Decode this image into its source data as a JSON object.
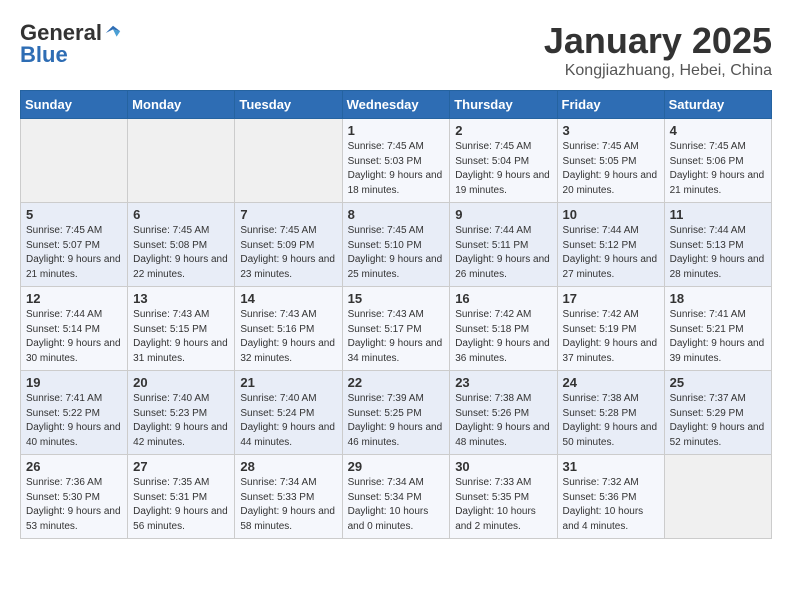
{
  "header": {
    "logo": {
      "general": "General",
      "blue": "Blue"
    },
    "title": "January 2025",
    "subtitle": "Kongjiazhuang, Hebei, China"
  },
  "weekdays": [
    "Sunday",
    "Monday",
    "Tuesday",
    "Wednesday",
    "Thursday",
    "Friday",
    "Saturday"
  ],
  "weeks": [
    [
      {
        "day": "",
        "sunrise": "",
        "sunset": "",
        "daylight": ""
      },
      {
        "day": "",
        "sunrise": "",
        "sunset": "",
        "daylight": ""
      },
      {
        "day": "",
        "sunrise": "",
        "sunset": "",
        "daylight": ""
      },
      {
        "day": "1",
        "sunrise": "Sunrise: 7:45 AM",
        "sunset": "Sunset: 5:03 PM",
        "daylight": "Daylight: 9 hours and 18 minutes."
      },
      {
        "day": "2",
        "sunrise": "Sunrise: 7:45 AM",
        "sunset": "Sunset: 5:04 PM",
        "daylight": "Daylight: 9 hours and 19 minutes."
      },
      {
        "day": "3",
        "sunrise": "Sunrise: 7:45 AM",
        "sunset": "Sunset: 5:05 PM",
        "daylight": "Daylight: 9 hours and 20 minutes."
      },
      {
        "day": "4",
        "sunrise": "Sunrise: 7:45 AM",
        "sunset": "Sunset: 5:06 PM",
        "daylight": "Daylight: 9 hours and 21 minutes."
      }
    ],
    [
      {
        "day": "5",
        "sunrise": "Sunrise: 7:45 AM",
        "sunset": "Sunset: 5:07 PM",
        "daylight": "Daylight: 9 hours and 21 minutes."
      },
      {
        "day": "6",
        "sunrise": "Sunrise: 7:45 AM",
        "sunset": "Sunset: 5:08 PM",
        "daylight": "Daylight: 9 hours and 22 minutes."
      },
      {
        "day": "7",
        "sunrise": "Sunrise: 7:45 AM",
        "sunset": "Sunset: 5:09 PM",
        "daylight": "Daylight: 9 hours and 23 minutes."
      },
      {
        "day": "8",
        "sunrise": "Sunrise: 7:45 AM",
        "sunset": "Sunset: 5:10 PM",
        "daylight": "Daylight: 9 hours and 25 minutes."
      },
      {
        "day": "9",
        "sunrise": "Sunrise: 7:44 AM",
        "sunset": "Sunset: 5:11 PM",
        "daylight": "Daylight: 9 hours and 26 minutes."
      },
      {
        "day": "10",
        "sunrise": "Sunrise: 7:44 AM",
        "sunset": "Sunset: 5:12 PM",
        "daylight": "Daylight: 9 hours and 27 minutes."
      },
      {
        "day": "11",
        "sunrise": "Sunrise: 7:44 AM",
        "sunset": "Sunset: 5:13 PM",
        "daylight": "Daylight: 9 hours and 28 minutes."
      }
    ],
    [
      {
        "day": "12",
        "sunrise": "Sunrise: 7:44 AM",
        "sunset": "Sunset: 5:14 PM",
        "daylight": "Daylight: 9 hours and 30 minutes."
      },
      {
        "day": "13",
        "sunrise": "Sunrise: 7:43 AM",
        "sunset": "Sunset: 5:15 PM",
        "daylight": "Daylight: 9 hours and 31 minutes."
      },
      {
        "day": "14",
        "sunrise": "Sunrise: 7:43 AM",
        "sunset": "Sunset: 5:16 PM",
        "daylight": "Daylight: 9 hours and 32 minutes."
      },
      {
        "day": "15",
        "sunrise": "Sunrise: 7:43 AM",
        "sunset": "Sunset: 5:17 PM",
        "daylight": "Daylight: 9 hours and 34 minutes."
      },
      {
        "day": "16",
        "sunrise": "Sunrise: 7:42 AM",
        "sunset": "Sunset: 5:18 PM",
        "daylight": "Daylight: 9 hours and 36 minutes."
      },
      {
        "day": "17",
        "sunrise": "Sunrise: 7:42 AM",
        "sunset": "Sunset: 5:19 PM",
        "daylight": "Daylight: 9 hours and 37 minutes."
      },
      {
        "day": "18",
        "sunrise": "Sunrise: 7:41 AM",
        "sunset": "Sunset: 5:21 PM",
        "daylight": "Daylight: 9 hours and 39 minutes."
      }
    ],
    [
      {
        "day": "19",
        "sunrise": "Sunrise: 7:41 AM",
        "sunset": "Sunset: 5:22 PM",
        "daylight": "Daylight: 9 hours and 40 minutes."
      },
      {
        "day": "20",
        "sunrise": "Sunrise: 7:40 AM",
        "sunset": "Sunset: 5:23 PM",
        "daylight": "Daylight: 9 hours and 42 minutes."
      },
      {
        "day": "21",
        "sunrise": "Sunrise: 7:40 AM",
        "sunset": "Sunset: 5:24 PM",
        "daylight": "Daylight: 9 hours and 44 minutes."
      },
      {
        "day": "22",
        "sunrise": "Sunrise: 7:39 AM",
        "sunset": "Sunset: 5:25 PM",
        "daylight": "Daylight: 9 hours and 46 minutes."
      },
      {
        "day": "23",
        "sunrise": "Sunrise: 7:38 AM",
        "sunset": "Sunset: 5:26 PM",
        "daylight": "Daylight: 9 hours and 48 minutes."
      },
      {
        "day": "24",
        "sunrise": "Sunrise: 7:38 AM",
        "sunset": "Sunset: 5:28 PM",
        "daylight": "Daylight: 9 hours and 50 minutes."
      },
      {
        "day": "25",
        "sunrise": "Sunrise: 7:37 AM",
        "sunset": "Sunset: 5:29 PM",
        "daylight": "Daylight: 9 hours and 52 minutes."
      }
    ],
    [
      {
        "day": "26",
        "sunrise": "Sunrise: 7:36 AM",
        "sunset": "Sunset: 5:30 PM",
        "daylight": "Daylight: 9 hours and 53 minutes."
      },
      {
        "day": "27",
        "sunrise": "Sunrise: 7:35 AM",
        "sunset": "Sunset: 5:31 PM",
        "daylight": "Daylight: 9 hours and 56 minutes."
      },
      {
        "day": "28",
        "sunrise": "Sunrise: 7:34 AM",
        "sunset": "Sunset: 5:33 PM",
        "daylight": "Daylight: 9 hours and 58 minutes."
      },
      {
        "day": "29",
        "sunrise": "Sunrise: 7:34 AM",
        "sunset": "Sunset: 5:34 PM",
        "daylight": "Daylight: 10 hours and 0 minutes."
      },
      {
        "day": "30",
        "sunrise": "Sunrise: 7:33 AM",
        "sunset": "Sunset: 5:35 PM",
        "daylight": "Daylight: 10 hours and 2 minutes."
      },
      {
        "day": "31",
        "sunrise": "Sunrise: 7:32 AM",
        "sunset": "Sunset: 5:36 PM",
        "daylight": "Daylight: 10 hours and 4 minutes."
      },
      {
        "day": "",
        "sunrise": "",
        "sunset": "",
        "daylight": ""
      }
    ]
  ]
}
